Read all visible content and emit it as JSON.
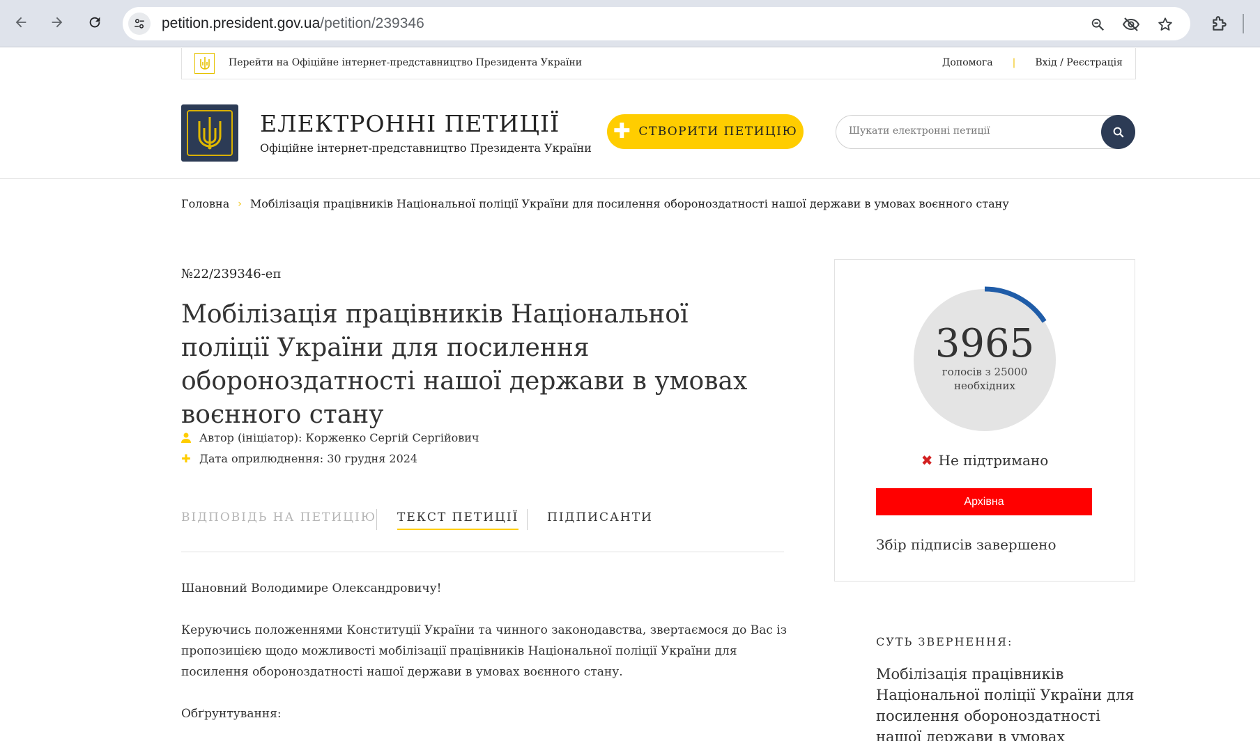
{
  "browser": {
    "url_host": "petition.president.gov.ua",
    "url_path": "/petition/239346"
  },
  "topbar": {
    "official_link": "Перейти на Офіційне інтернет-представництво Президента України",
    "help": "Допомога",
    "separator": "|",
    "login": "Вхід / Реєстрація"
  },
  "header": {
    "title": "ЕЛЕКТРОННІ ПЕТИЦІЇ",
    "subtitle": "Офіційне інтернет-представництво Президента України",
    "create_label": "СТВОРИТИ ПЕТИЦІЮ",
    "search_placeholder": "Шукати електронні петиції"
  },
  "breadcrumb": {
    "home": "Головна",
    "separator": "›",
    "current": "Мобілізація працівників Національної поліції України для посилення обороноздатності нашої держави в умовах воєнного стану"
  },
  "petition": {
    "number": "№22/239346-еп",
    "title": "Мобілізація працівників Національної поліції України для посилення обороноздатності нашої держави в умовах воєнного стану",
    "author": "Автор (ініціатор): Корженко Сергій Сергійович",
    "date": "Дата оприлюднення: 30 грудня 2024",
    "tabs": [
      "ВІДПОВІДЬ НА ПЕТИЦІЮ",
      "ТЕКСТ ПЕТИЦІЇ",
      "ПІДПИСАНТИ"
    ],
    "active_tab": 1,
    "greeting": "Шановний Володимире Олександровичу!",
    "paragraph1": "Керуючись положеннями Конституції України та чинного законодавства, звертаємося до Вас із пропозицією щодо можливості мобілізації працівників Національної поліції України для посилення обороноздатності нашої держави в умовах воєнного стану.",
    "justification": "Обґрунтування:"
  },
  "sidebar": {
    "votes": 3965,
    "votes_count": "3965",
    "votes_caption_1": "голосів з 25000",
    "votes_caption_2": "необхідних",
    "votes_needed": 25000,
    "status": "Не підтримано",
    "archive": "Архівна",
    "collection_done": "Збір підписів завершено",
    "essence_label": "СУТЬ ЗВЕРНЕННЯ:",
    "essence_text": "Мобілізація працівників Національної поліції України для посилення обороноздатності нашої держави в умовах воєнного стану"
  },
  "colors": {
    "accent_yellow": "#ffcd00",
    "navy": "#2c3b55",
    "gauge_bg": "#e4e4e4",
    "gauge_fill": "#1f5ca8",
    "archive_red": "#ff0000",
    "status_red": "#d32020"
  },
  "icons": {
    "back": "arrow-left-icon",
    "forward": "arrow-right-icon",
    "reload": "reload-icon",
    "site_info": "tune-icon",
    "zoom": "zoom-icon",
    "tracking": "eye-off-icon",
    "bookmark": "star-icon",
    "extensions": "puzzle-icon",
    "search": "search-icon",
    "author": "person-icon",
    "date": "plus-icon",
    "status": "cross-icon"
  }
}
